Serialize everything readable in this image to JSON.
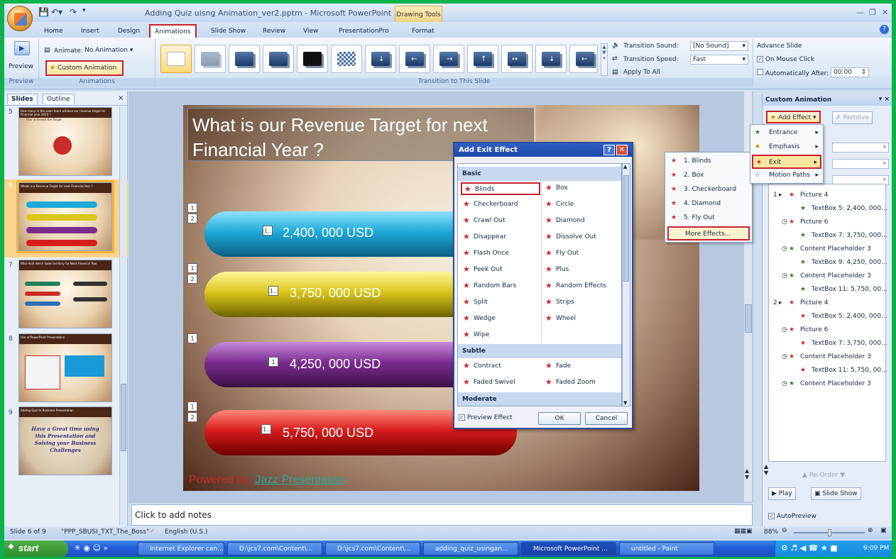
{
  "app": {
    "title": "Adding Quiz uisng Animation_ver2.pptm - Microsoft PowerPoint",
    "contextual_tab_group": "Drawing Tools",
    "qat_icons": [
      "save-icon",
      "undo-icon",
      "redo-icon"
    ]
  },
  "tabs": [
    "Home",
    "Insert",
    "Design",
    "Animations",
    "Slide Show",
    "Review",
    "View",
    "PresentationPro",
    "Format"
  ],
  "active_tab": "Animations",
  "ribbon": {
    "preview_label": "Preview",
    "preview_group": "Preview",
    "animate_label": "Animate:",
    "animate_value": "No Animation",
    "custom_animation_label": "Custom Animation",
    "animations_group": "Animations",
    "transition_group": "Transition to This Slide",
    "transition_sound_label": "Transition Sound:",
    "transition_sound_value": "[No Sound]",
    "transition_speed_label": "Transition Speed:",
    "transition_speed_value": "Fast",
    "apply_to_all": "Apply To All",
    "advance_slide_label": "Advance Slide",
    "on_mouse_click": "On Mouse Click",
    "on_mouse_click_checked": true,
    "automatically_after": "Automatically After:",
    "automatically_after_value": "00:00"
  },
  "slides_pane": {
    "tabs": [
      "Slides",
      "Outline"
    ],
    "slides": [
      {
        "num": "5",
        "title": "How many in the sales team achieve our revenue target for Financial year 2010 ?",
        "subtitle": "Four achieved the Target"
      },
      {
        "num": "6",
        "title": "Whats our Revenue Target for next Financial Year ?",
        "selected": true
      },
      {
        "num": "7",
        "title": "Who Hold which Sales territory for Next Financial Year"
      },
      {
        "num": "8",
        "title": "Use of PowerPoint Presentation"
      },
      {
        "num": "9",
        "title": "Adding Quiz to Business Presentation",
        "body": "Have a Great time using this Presentation and Solving your Business Challenges"
      }
    ]
  },
  "slide": {
    "title": "What is our Revenue  Target for next Financial Year ?",
    "bars": [
      {
        "label": "2,400, 000 USD",
        "tag": "1..",
        "color": "#1ea9d8",
        "order_tags": [
          "1",
          "2"
        ]
      },
      {
        "label": "3,750, 000 USD",
        "tag": "1..",
        "color": "#d9c71a",
        "order_tags": [
          "1",
          "2"
        ]
      },
      {
        "label": "4,250, 000 USD",
        "tag": "1",
        "color": "#7b2d8f",
        "order_tags": [
          "1"
        ]
      },
      {
        "label": "5,750, 000 USD",
        "tag": "1..",
        "color": "#d61c1c",
        "order_tags": [
          "1",
          "2"
        ]
      }
    ],
    "powered_by": "Powered by:",
    "powered_link": "Jazz Presentation"
  },
  "notes_placeholder": "Click to add notes",
  "dialog": {
    "title": "Add Exit Effect",
    "sections": [
      {
        "name": "Basic",
        "effects": [
          "Blinds",
          "Box",
          "Checkerboard",
          "Circle",
          "Crawl Out",
          "Diamond",
          "Disappear",
          "Dissolve Out",
          "Flash Once",
          "Fly Out",
          "Peek Out",
          "Plus",
          "Random Bars",
          "Random Effects",
          "Split",
          "Strips",
          "Wedge",
          "Wheel",
          "Wipe"
        ]
      },
      {
        "name": "Subtle",
        "effects": [
          "Contract",
          "Fade",
          "Faded Swivel",
          "Faded Zoom"
        ]
      },
      {
        "name": "Moderate",
        "effects": []
      }
    ],
    "selected_effect": "Blinds",
    "preview_effect": "Preview Effect",
    "preview_effect_checked": true,
    "ok": "OK",
    "cancel": "Cancel"
  },
  "add_effect_menu": {
    "items": [
      "Entrance",
      "Emphasis",
      "Exit",
      "Motion Paths"
    ],
    "highlighted": "Exit"
  },
  "exit_submenu": {
    "items": [
      "1. Blinds",
      "2. Box",
      "3. Checkerboard",
      "4. Diamond",
      "5. Fly Out",
      "More Effects..."
    ]
  },
  "task_pane": {
    "title": "Custom Animation",
    "add_effect": "Add Effect",
    "remove": "Remove",
    "animations": [
      {
        "step": "1",
        "name": "Picture 4",
        "kind": "click"
      },
      {
        "name": "TextBox 5: 2,400, 000...",
        "kind": "with"
      },
      {
        "name": "Picture 6",
        "kind": "after"
      },
      {
        "name": "TextBox 7: 3,750, 000...",
        "kind": "with"
      },
      {
        "name": "Content Placeholder 3",
        "kind": "after"
      },
      {
        "name": "TextBox 9: 4,250, 000...",
        "kind": "with"
      },
      {
        "name": "Content Placeholder 3",
        "kind": "after"
      },
      {
        "name": "TextBox 11: 5,750, 00...",
        "kind": "with"
      },
      {
        "step": "2",
        "name": "Picture 4",
        "kind": "click"
      },
      {
        "name": "TextBox 5: 2,400, 000...",
        "kind": "with"
      },
      {
        "name": "Picture 6",
        "kind": "after"
      },
      {
        "name": "TextBox 7: 3,750, 000...",
        "kind": "with"
      },
      {
        "name": "Content Placeholder 3",
        "kind": "after"
      },
      {
        "name": "TextBox 11: 5,750, 00...",
        "kind": "with"
      },
      {
        "name": "Content Placeholder 3",
        "kind": "after"
      }
    ],
    "reorder": "Re-Order",
    "play": "Play",
    "slide_show": "Slide Show",
    "autopreview": "AutoPreview",
    "autopreview_checked": true
  },
  "statusbar": {
    "slide_info": "Slide 6 of 9",
    "theme": "\"PPP_SBUSI_TXT_The_Boss\"",
    "language": "English (U.S.)",
    "zoom": "88%"
  },
  "taskbar": {
    "start": "start",
    "buttons": [
      "Internet Explorer can...",
      "D:\\jcs7.com\\Content\\...",
      "D:\\jcs7.com\\Content\\...",
      "adding_quiz_usingan...",
      "Microsoft PowerPoint ...",
      "untitled - Paint"
    ],
    "active": "Microsoft PowerPoint ...",
    "clock": "9:09 PM"
  }
}
